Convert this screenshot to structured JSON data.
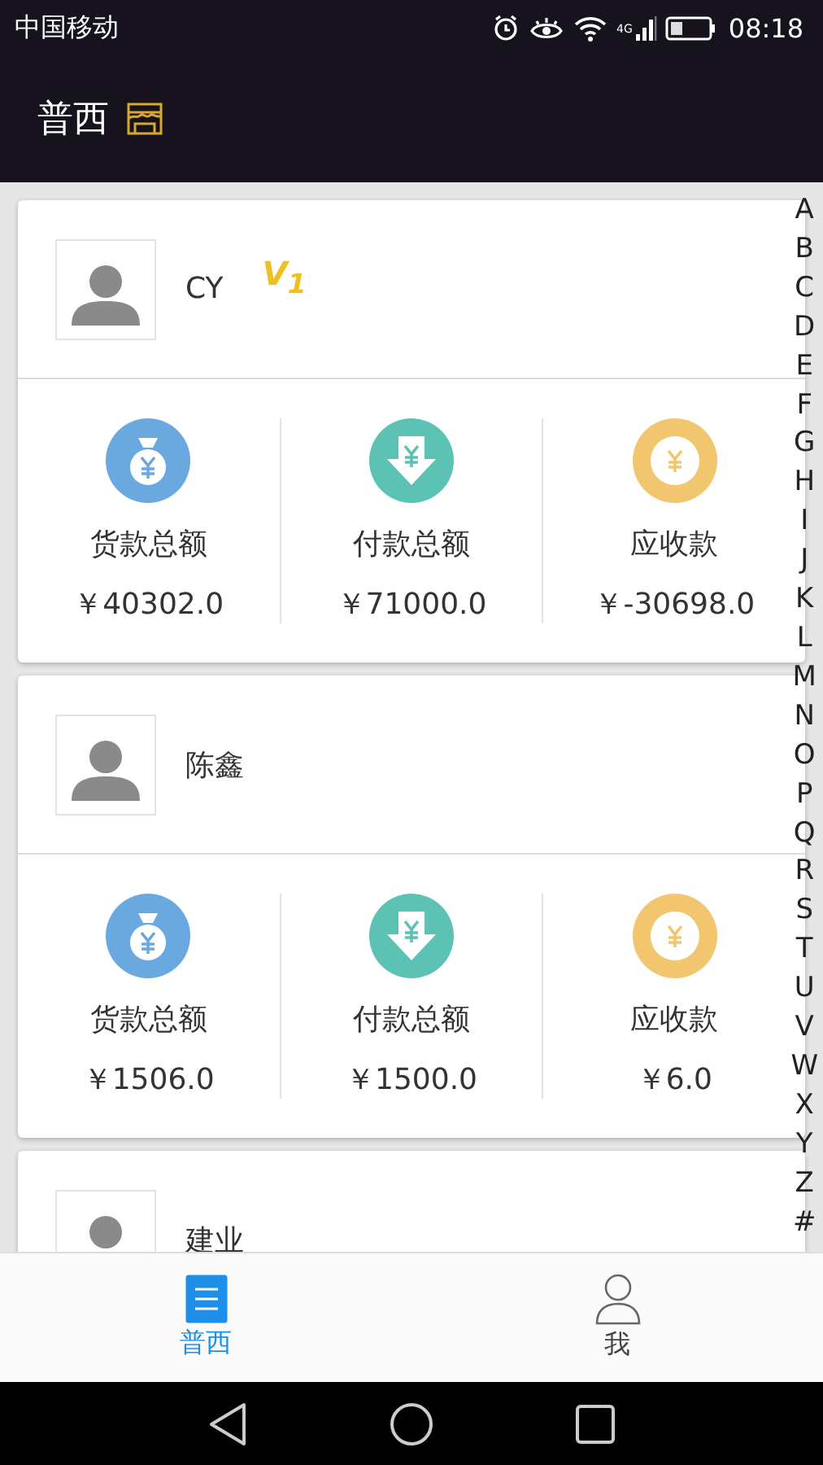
{
  "status_bar": {
    "carrier": "中国移动",
    "network": "4G",
    "time": "08:18"
  },
  "app_bar": {
    "title": "普西"
  },
  "contacts": [
    {
      "name": "CY",
      "badge": "V$_{1}$",
      "stats": [
        {
          "kind": "bag",
          "label": "货款总额",
          "value": "￥40302.0"
        },
        {
          "kind": "down",
          "label": "付款总额",
          "value": "￥71000.0"
        },
        {
          "kind": "coin",
          "label": "应收款",
          "value": "￥-30698.0"
        }
      ]
    },
    {
      "name": "陈鑫",
      "stats": [
        {
          "kind": "bag",
          "label": "货款总额",
          "value": "￥1506.0"
        },
        {
          "kind": "down",
          "label": "付款总额",
          "value": "￥1500.0"
        },
        {
          "kind": "coin",
          "label": "应收款",
          "value": "￥6.0"
        }
      ]
    },
    {
      "name": "建业"
    }
  ],
  "index_bar": [
    "A",
    "B",
    "C",
    "D",
    "E",
    "F",
    "G",
    "H",
    "I",
    "J",
    "K",
    "L",
    "M",
    "N",
    "O",
    "P",
    "Q",
    "R",
    "S",
    "T",
    "U",
    "V",
    "W",
    "X",
    "Y",
    "Z",
    "#"
  ],
  "tab_bar": [
    {
      "kind": "list",
      "label": "普西",
      "selected": true
    },
    {
      "kind": "person",
      "label": "我",
      "selected": false
    }
  ]
}
